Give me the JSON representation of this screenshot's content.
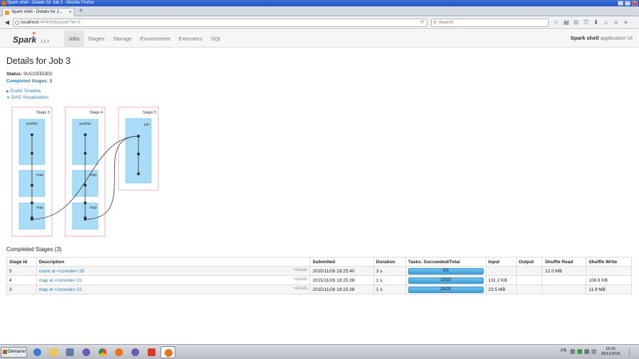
{
  "window": {
    "title": "Spark shell - Details for Job 3 - Mozilla Firefox"
  },
  "browser": {
    "tab_title": "Spark shell - Details for J...",
    "url_host": "localhost",
    "url_path": ":4040/jobs/job/?id=3",
    "search_placeholder": "Search"
  },
  "spark": {
    "version": "1.5.2",
    "nav": [
      "Jobs",
      "Stages",
      "Storage",
      "Environment",
      "Executors",
      "SQL"
    ],
    "active_nav": "Jobs",
    "app_name": "Spark shell",
    "app_suffix": "application UI"
  },
  "page": {
    "title": "Details for Job 3",
    "status_label": "Status:",
    "status_value": "SUCCEEDED",
    "completed_label": "Completed Stages:",
    "completed_value": "3",
    "event_timeline": "Event Timeline",
    "dag_visualization": "DAG Visualization"
  },
  "dag": {
    "stages": [
      {
        "title": "Stage 3",
        "ops": [
          "textFile",
          "map",
          "map"
        ]
      },
      {
        "title": "Stage 4",
        "ops": [
          "textFile",
          "map",
          "map"
        ]
      },
      {
        "title": "Stage 5",
        "ops": [
          "join"
        ]
      }
    ]
  },
  "table": {
    "section_title": "Completed Stages (3)",
    "headers": [
      "Stage Id",
      "Description",
      "Submitted",
      "Duration",
      "Tasks: Succeeded/Total",
      "Input",
      "Output",
      "Shuffle Read",
      "Shuffle Write"
    ],
    "details_label": "+details",
    "rows": [
      {
        "id": "5",
        "desc": "count at <console>:28",
        "submitted": "2015/11/26 18:25:40",
        "duration": "3 s",
        "tasks": "5/5",
        "progress": 1.0,
        "input": "",
        "output": "",
        "shuffle_read": "12.0 MB",
        "shuffle_write": ""
      },
      {
        "id": "4",
        "desc": "map at <console>:21",
        "submitted": "2015/11/26 18:25:38",
        "duration": "1 s",
        "tasks": "10/10",
        "progress": 1.0,
        "input": "131.2 KB",
        "output": "",
        "shuffle_read": "",
        "shuffle_write": "108.6 KB"
      },
      {
        "id": "3",
        "desc": "map at <console>:21",
        "submitted": "2015/11/26 18:25:38",
        "duration": "1 s",
        "tasks": "20/20",
        "progress": 1.0,
        "input": "23.5 MB",
        "output": "",
        "shuffle_read": "",
        "shuffle_write": "11.9 MB"
      }
    ]
  },
  "taskbar": {
    "start_label": "Démarrer",
    "lang": "FR",
    "time": "18:26",
    "date": "26/11/2015"
  },
  "colors": {
    "stage_border": "#e8a0a8",
    "op_fill": "#a9dcf7",
    "op_border": "#7cc3e8",
    "link": "#2a7ab0"
  }
}
